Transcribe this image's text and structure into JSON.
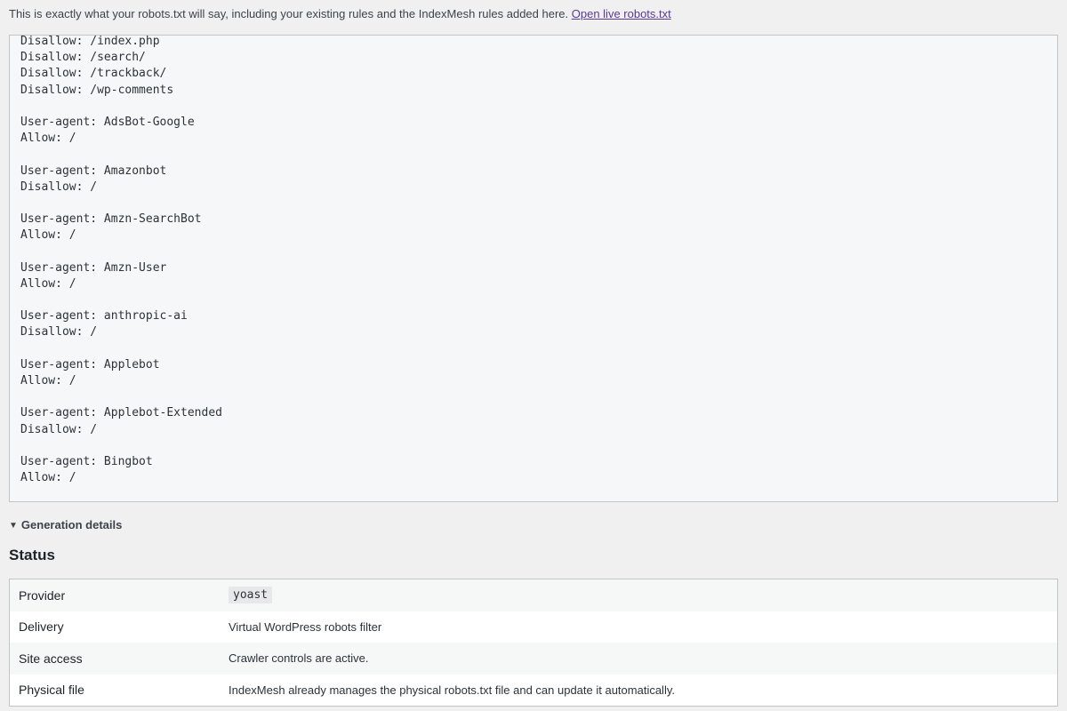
{
  "intro": {
    "text": "This is exactly what your robots.txt will say, including your existing rules and the IndexMesh rules added here.",
    "link_label": "Open live robots.txt"
  },
  "preview": {
    "lines": [
      "Disallow: /index.php",
      "Disallow: /search/",
      "Disallow: /trackback/",
      "Disallow: /wp-comments",
      "",
      "User-agent: AdsBot-Google",
      "Allow: /",
      "",
      "User-agent: Amazonbot",
      "Disallow: /",
      "",
      "User-agent: Amzn-SearchBot",
      "Allow: /",
      "",
      "User-agent: Amzn-User",
      "Allow: /",
      "",
      "User-agent: anthropic-ai",
      "Disallow: /",
      "",
      "User-agent: Applebot",
      "Allow: /",
      "",
      "User-agent: Applebot-Extended",
      "Disallow: /",
      "",
      "User-agent: Bingbot",
      "Allow: /"
    ]
  },
  "details": {
    "summary_label": "Generation details"
  },
  "status": {
    "title": "Status",
    "rows": [
      {
        "label": "Provider",
        "value": "yoast",
        "is_code": true
      },
      {
        "label": "Delivery",
        "value": "Virtual WordPress robots filter",
        "is_code": false
      },
      {
        "label": "Site access",
        "value": "Crawler controls are active.",
        "is_code": false
      },
      {
        "label": "Physical file",
        "value": "IndexMesh already manages the physical robots.txt file and can update it automatically.",
        "is_code": false
      }
    ]
  }
}
